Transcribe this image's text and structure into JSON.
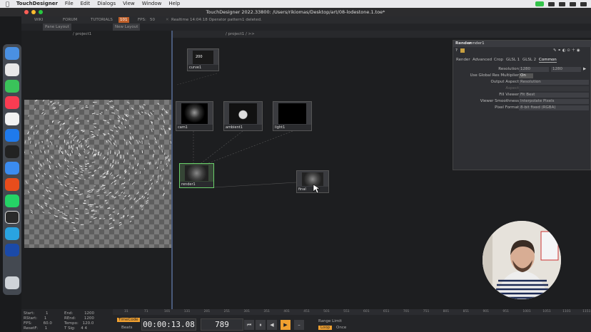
{
  "menubar": {
    "app": "TouchDesigner",
    "items": [
      "File",
      "Edit",
      "Dialogs",
      "View",
      "Window",
      "Help"
    ]
  },
  "window": {
    "title": "TouchDesigner 2022.33800: /Users/rikiomas/Desktop/art/08-lodestone.1.toe*"
  },
  "toolbar": {
    "wiki": "WIKI",
    "forum": "FORUM",
    "tutorials": "TUTORIALS",
    "badge": "101",
    "fps_label": "FPS:",
    "fps_value": "50",
    "realtime": "Realtime",
    "status_message": "14:04:18 Operator pattern1 deleted."
  },
  "panebar": {
    "pane_layout": "Pane Layout",
    "new_layout": "New Layout",
    "left_path": "/ project1",
    "right_path": "/ project1 / >>"
  },
  "nodes": [
    {
      "id": "curve",
      "label": "curve1",
      "value": "200"
    },
    {
      "id": "cam",
      "label": "cam1"
    },
    {
      "id": "ambient",
      "label": "ambient1"
    },
    {
      "id": "light",
      "label": "light1"
    },
    {
      "id": "render",
      "label": "render1"
    },
    {
      "id": "final",
      "label": "final"
    }
  ],
  "params": {
    "type": "Render",
    "name": "render1",
    "tabs": [
      "Render",
      "Advanced",
      "Crop",
      "GLSL 1",
      "GLSL 2",
      "Common"
    ],
    "active_tab": "Common",
    "rows": [
      {
        "label": "Resolution",
        "value": "1280",
        "value2": "1280"
      },
      {
        "label": "Use Global Res Multiplier",
        "value": "On"
      },
      {
        "label": "Output Aspect",
        "value": "Resolution"
      },
      {
        "label": "Aspect",
        "value": ""
      },
      {
        "label": "Fill Viewer",
        "value": "Fit Best"
      },
      {
        "label": "Viewer Smoothness",
        "value": "Interpolate Pixels"
      },
      {
        "label": "Pixel Format",
        "value": "8-bit fixed (RGBA)"
      }
    ]
  },
  "timeline": {
    "start_label": "Start:",
    "start": "1",
    "end_label": "End:",
    "end": "1200",
    "rstart_label": "RStart:",
    "rstart": "1",
    "rend_label": "REnd:",
    "rend": "1200",
    "fps_label": "FPS:",
    "fps": "60.0",
    "tempo_label": "Tempo:",
    "tempo": "120.0",
    "resetf_label": "ResetF:",
    "resetf": "1",
    "tsig_label": "T Sig:",
    "tsig": "4    4",
    "timecode_label": "TimeCode",
    "beats_label": "Beats",
    "timecode": "00:00:13.08",
    "frame": "789",
    "range_limit": "Range Limit",
    "loop": "Loop",
    "once": "Once",
    "ticks": [
      "31",
      "71",
      "101",
      "131",
      "201",
      "251",
      "301",
      "351",
      "401",
      "451",
      "501",
      "551",
      "601",
      "651",
      "701",
      "751",
      "801",
      "851",
      "901",
      "951",
      "1001",
      "1051",
      "1101",
      "1151"
    ]
  },
  "colors": {
    "accent": "#f0a030",
    "selected_node": "#6ad06a",
    "param_bg": "#2e2f33"
  }
}
